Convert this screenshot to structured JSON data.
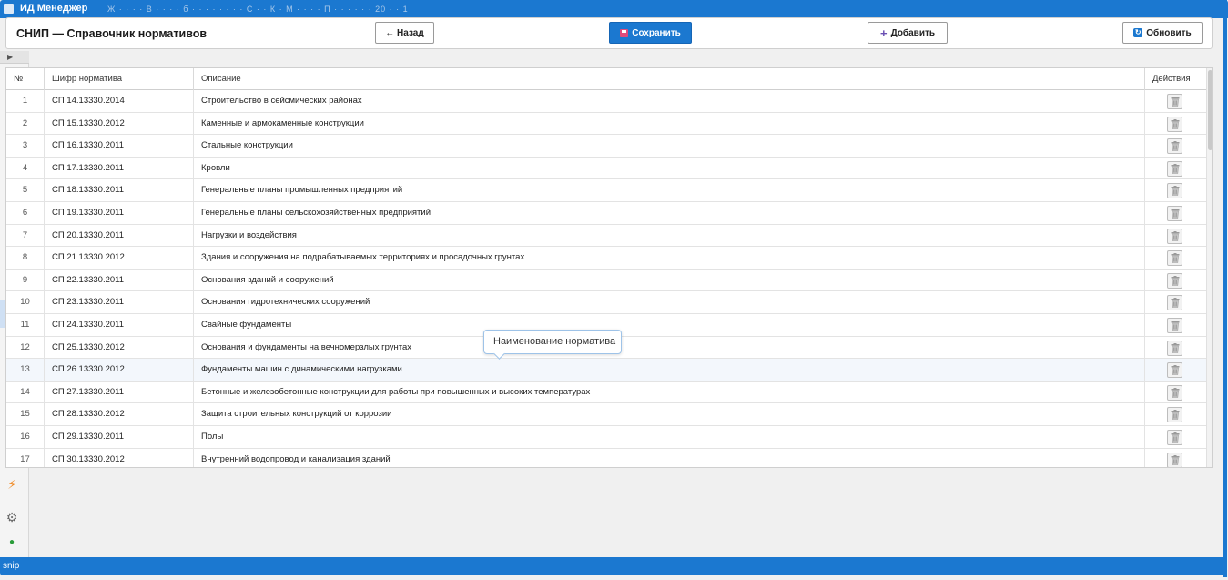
{
  "app": {
    "title": "ИД Менеджер",
    "subtitle": "Ж · · · · В · · · · б · · · · · · · · С · · К · М · · · · П · · · · · · 20 · · 1",
    "status_text": "snip"
  },
  "dialog": {
    "title": "СНИП — Справочник нормативов",
    "buttons": {
      "back": "← Назад",
      "save": "Сохранить",
      "add": "Добавить",
      "refresh": "Обновить"
    },
    "icons": {
      "save": "floppy-icon",
      "add": "plus-icon",
      "refresh": "refresh-icon",
      "delete": "trash-icon"
    }
  },
  "rail": {
    "expand": "▶",
    "flash": "⚡",
    "gear": "⚙",
    "dot": "●"
  },
  "table": {
    "headers": {
      "num": "№",
      "code": "Шифр норматива",
      "desc": "Описание",
      "actions": "Действия"
    },
    "rows": [
      {
        "num": "1",
        "code": "СП 14.13330.2014",
        "desc": "Строительство в сейсмических районах"
      },
      {
        "num": "2",
        "code": "СП 15.13330.2012",
        "desc": "Каменные и армокаменные конструкции"
      },
      {
        "num": "3",
        "code": "СП 16.13330.2011",
        "desc": "Стальные конструкции"
      },
      {
        "num": "4",
        "code": "СП 17.13330.2011",
        "desc": "Кровли"
      },
      {
        "num": "5",
        "code": "СП 18.13330.2011",
        "desc": "Генеральные планы промышленных предприятий"
      },
      {
        "num": "6",
        "code": "СП 19.13330.2011",
        "desc": "Генеральные планы сельскохозяйственных предприятий"
      },
      {
        "num": "7",
        "code": "СП 20.13330.2011",
        "desc": "Нагрузки и воздействия"
      },
      {
        "num": "8",
        "code": "СП 21.13330.2012",
        "desc": "Здания и сооружения на подрабатываемых территориях и просадочных грунтах"
      },
      {
        "num": "9",
        "code": "СП 22.13330.2011",
        "desc": "Основания зданий и сооружений"
      },
      {
        "num": "10",
        "code": "СП 23.13330.2011",
        "desc": "Основания гидротехнических сооружений"
      },
      {
        "num": "11",
        "code": "СП 24.13330.2011",
        "desc": "Свайные фундаменты"
      },
      {
        "num": "12",
        "code": "СП 25.13330.2012",
        "desc": "Основания и фундаменты на вечномерзлых грунтах"
      },
      {
        "num": "13",
        "code": "СП 26.13330.2012",
        "desc": "Фундаменты машин с динамическими нагрузками"
      },
      {
        "num": "14",
        "code": "СП 27.13330.2011",
        "desc": "Бетонные и железобетонные конструкции для работы при повышенных и высоких температурах"
      },
      {
        "num": "15",
        "code": "СП 28.13330.2012",
        "desc": "Защита строительных конструкций от коррозии"
      },
      {
        "num": "16",
        "code": "СП 29.13330.2011",
        "desc": "Полы"
      },
      {
        "num": "17",
        "code": "СП 30.13330.2012",
        "desc": "Внутренний водопровод и канализация зданий"
      }
    ],
    "highlighted_row": "13"
  },
  "tooltip": {
    "text": "Наименование норматива"
  },
  "colors": {
    "accent": "#1b78d0",
    "row_highlight": "#f3f7fc",
    "flash": "#f08a24",
    "online": "#2a9c3a"
  }
}
